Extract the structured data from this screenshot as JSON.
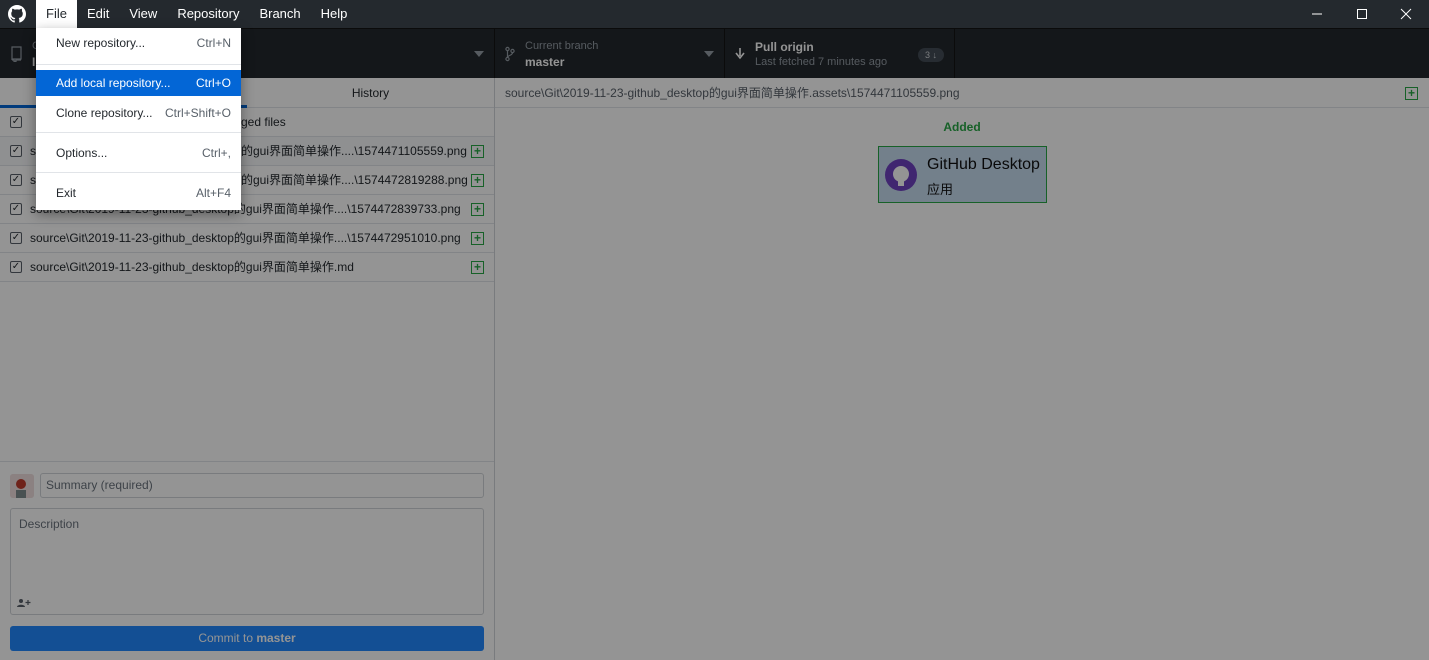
{
  "menubar": {
    "items": [
      "File",
      "Edit",
      "View",
      "Repository",
      "Branch",
      "Help"
    ]
  },
  "toolbar": {
    "repo_title": "C",
    "repo_value": "I",
    "branch_title": "Current branch",
    "branch_value": "master",
    "fetch_title": "Pull origin",
    "fetch_subtitle": "Last fetched 7 minutes ago",
    "fetch_badge": "3"
  },
  "tabs": {
    "changes": "",
    "history": "History"
  },
  "changes": {
    "header": "ged files",
    "files": [
      {
        "prefix": "so",
        "suffix": "的gui界面简单操作....\\1574471105559.png"
      },
      {
        "prefix": "so",
        "suffix": "的gui界面简单操作....\\1574472819288.png"
      },
      {
        "prefix": "source\\Git\\2019-11-23-github_desktop",
        "suffix": "的gui界面简单操作....\\1574472839733.png"
      },
      {
        "prefix": "source\\Git\\2019-11-23-github_desktop",
        "suffix": "的gui界面简单操作....\\1574472951010.png"
      },
      {
        "prefix": "source\\Git\\2019-11-23-github_desktop",
        "suffix": "的gui界面简单操作.md"
      }
    ]
  },
  "commit": {
    "summary_placeholder": "Summary (required)",
    "description_placeholder": "Description",
    "button_prefix": "Commit to ",
    "button_branch": "master"
  },
  "diff": {
    "path": "source\\Git\\2019-11-23-github_desktop的gui界面简单操作.assets\\1574471105559.png",
    "status": "Added",
    "preview_title": "GitHub Desktop",
    "preview_sub": "应用"
  },
  "file_menu": {
    "items": [
      {
        "label": "New repository...",
        "shortcut": "Ctrl+N"
      },
      {
        "label": "Add local repository...",
        "shortcut": "Ctrl+O"
      },
      {
        "label": "Clone repository...",
        "shortcut": "Ctrl+Shift+O"
      },
      {
        "label": "Options...",
        "shortcut": "Ctrl+,"
      },
      {
        "label": "Exit",
        "shortcut": "Alt+F4"
      }
    ]
  },
  "colors": {
    "titlebar": "#24292e",
    "accent": "#0366d6",
    "added": "#28a745"
  }
}
